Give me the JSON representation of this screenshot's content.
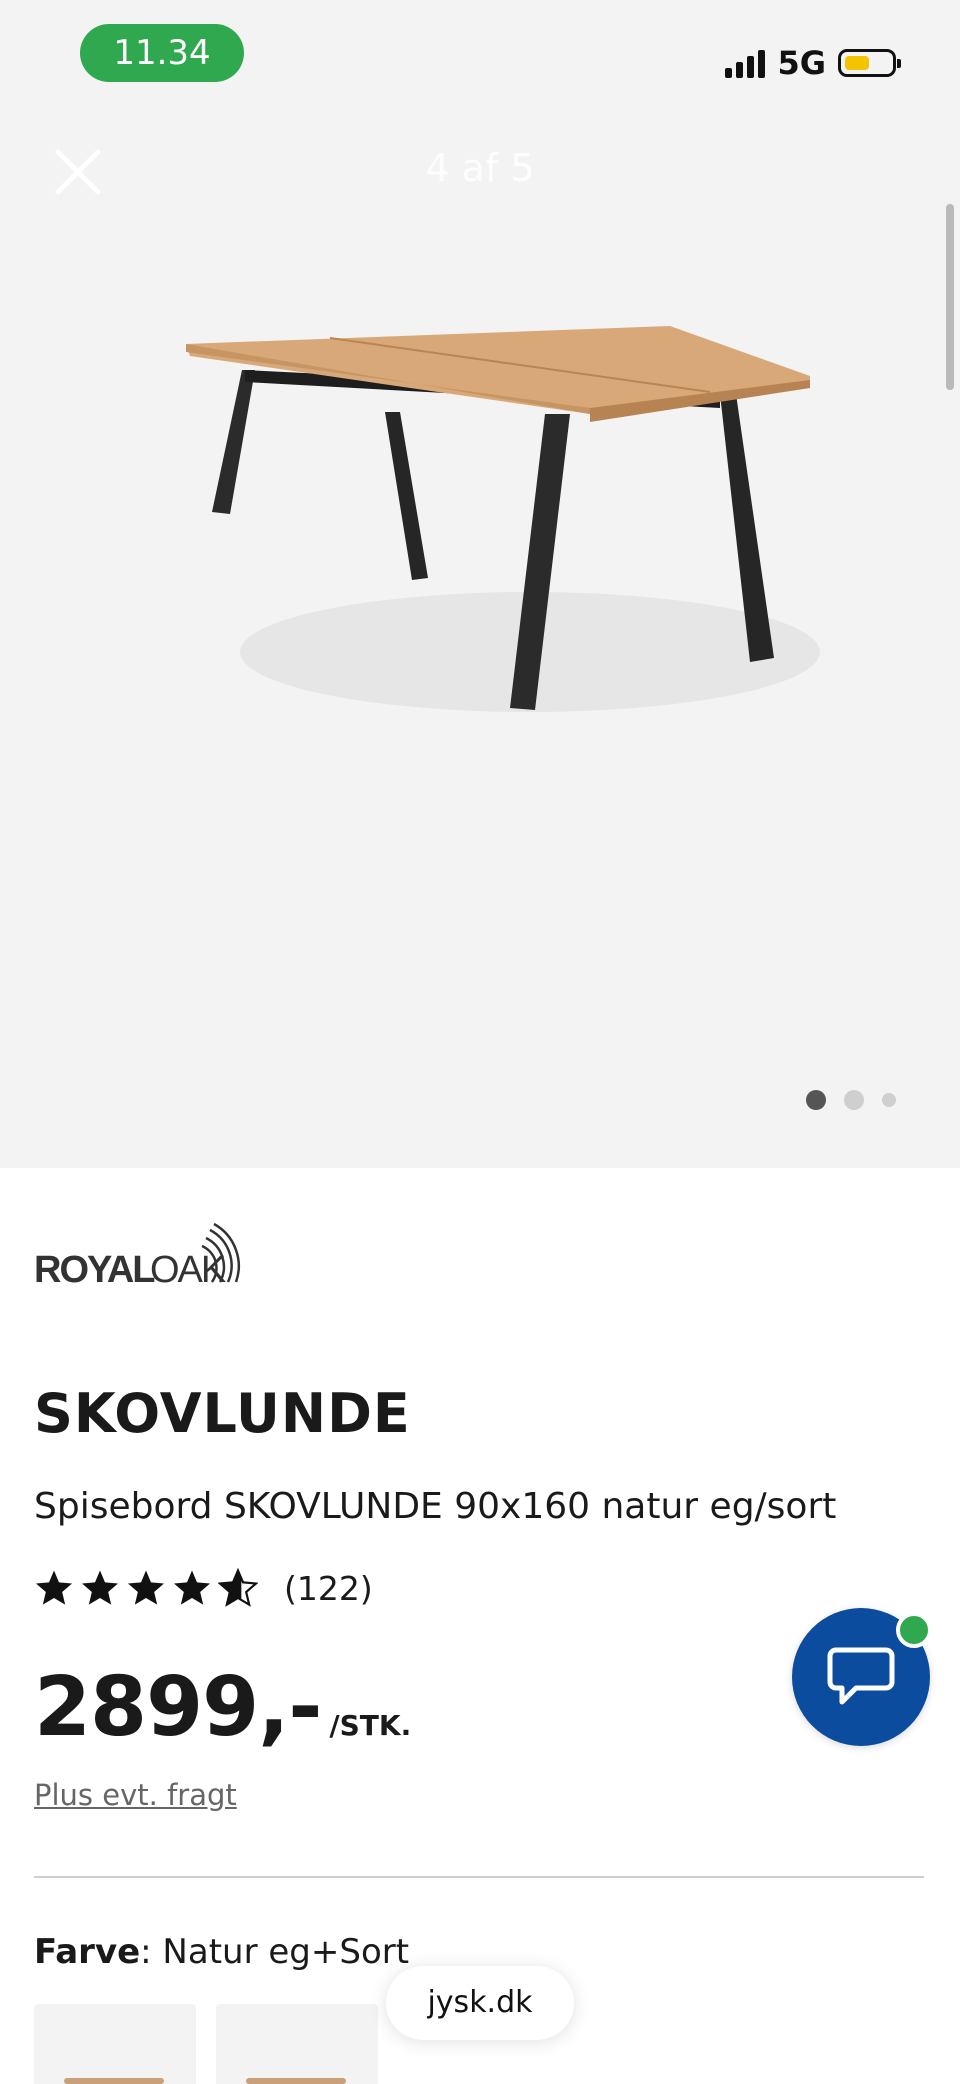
{
  "status_bar": {
    "time": "11.34",
    "network": "5G"
  },
  "gallery": {
    "counter": "4 af 5",
    "dots": [
      {
        "active": true
      },
      {
        "active": false
      },
      {
        "active": false
      }
    ]
  },
  "product": {
    "brand": "ROYAL OAK",
    "family": "SKOVLUNDE",
    "name": "Spisebord SKOVLUNDE 90x160 natur eg/sort",
    "rating": 4.5,
    "reviews": "(122)",
    "price": "2899,-",
    "price_unit": "/STK.",
    "freight_link": "Plus evt. fragt",
    "color_label": "Farve",
    "color_value": ": Natur eg+Sort"
  },
  "browser": {
    "url": "jysk.dk"
  },
  "colors": {
    "status_green": "#2fa84f",
    "chat_blue": "#0b4c9e",
    "background_gray": "#f3f3f3"
  },
  "icons": [
    "close-icon",
    "signal-icon",
    "battery-icon",
    "star-icon",
    "chat-icon"
  ]
}
